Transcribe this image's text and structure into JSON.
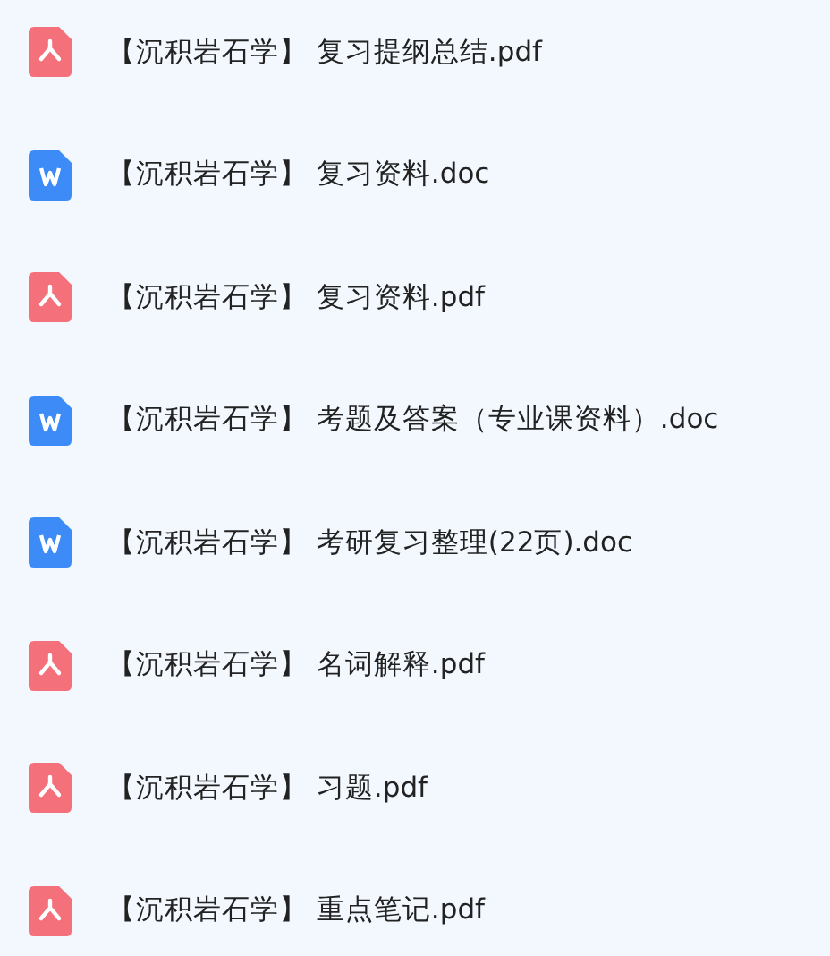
{
  "files": [
    {
      "kind": "pdf",
      "name": "【沉积岩石学】 复习提纲总结.pdf"
    },
    {
      "kind": "doc",
      "name": "【沉积岩石学】 复习资料.doc"
    },
    {
      "kind": "pdf",
      "name": "【沉积岩石学】 复习资料.pdf"
    },
    {
      "kind": "doc",
      "name": "【沉积岩石学】 考题及答案（专业课资料）.doc"
    },
    {
      "kind": "doc",
      "name": "【沉积岩石学】 考研复习整理(22页).doc"
    },
    {
      "kind": "pdf",
      "name": "【沉积岩石学】 名词解释.pdf"
    },
    {
      "kind": "pdf",
      "name": "【沉积岩石学】 习题.pdf"
    },
    {
      "kind": "pdf",
      "name": "【沉积岩石学】 重点笔记.pdf"
    }
  ]
}
